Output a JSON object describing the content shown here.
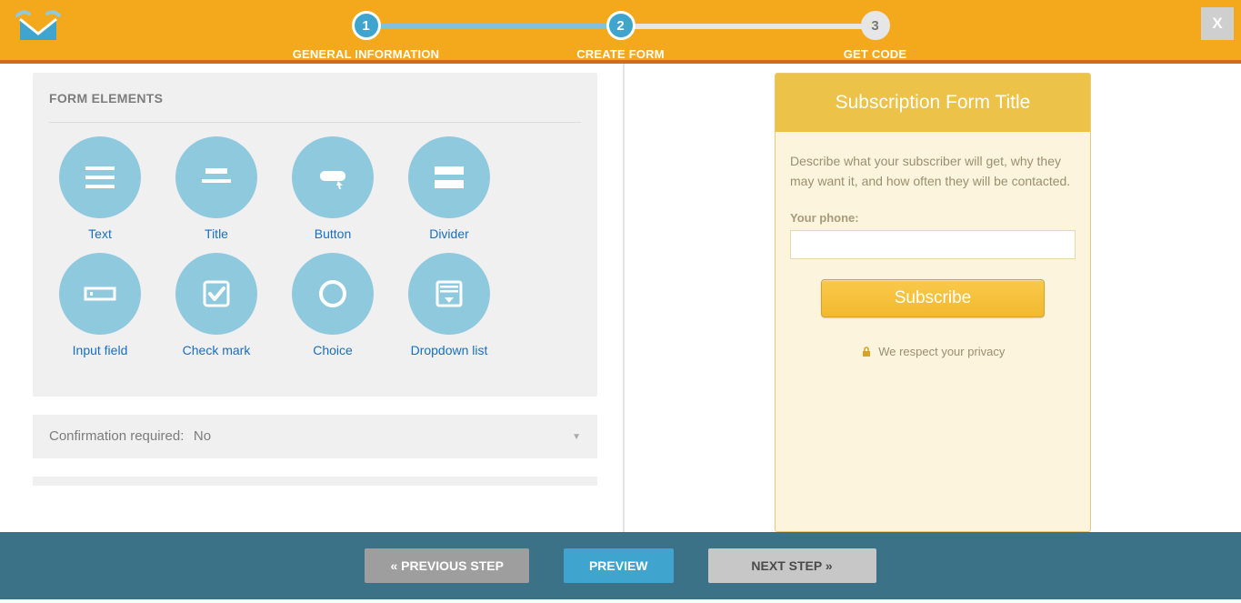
{
  "header": {
    "close": "X",
    "steps": [
      {
        "num": "1",
        "label": "GENERAL INFORMATION",
        "state": "active"
      },
      {
        "num": "2",
        "label": "CREATE FORM",
        "state": "active"
      },
      {
        "num": "3",
        "label": "GET CODE",
        "state": "pending"
      }
    ]
  },
  "form_elements": {
    "title": "FORM ELEMENTS",
    "items": [
      {
        "name": "text",
        "label": "Text"
      },
      {
        "name": "title",
        "label": "Title"
      },
      {
        "name": "button",
        "label": "Button"
      },
      {
        "name": "divider",
        "label": "Divider"
      },
      {
        "name": "input-field",
        "label": "Input field"
      },
      {
        "name": "check-mark",
        "label": "Check mark"
      },
      {
        "name": "choice",
        "label": "Choice"
      },
      {
        "name": "dropdown-list",
        "label": "Dropdown list"
      }
    ]
  },
  "config": {
    "confirmation_label": "Confirmation required:",
    "confirmation_value": "No"
  },
  "preview": {
    "title": "Subscription Form Title",
    "description": "Describe what your subscriber will get, why they may want it, and how often they will be contacted.",
    "phone_label": "Your phone:",
    "subscribe_label": "Subscribe",
    "privacy": "We respect your privacy"
  },
  "footer": {
    "prev": "« PREVIOUS STEP",
    "preview": "PREVIEW",
    "next": "NEXT STEP »"
  }
}
